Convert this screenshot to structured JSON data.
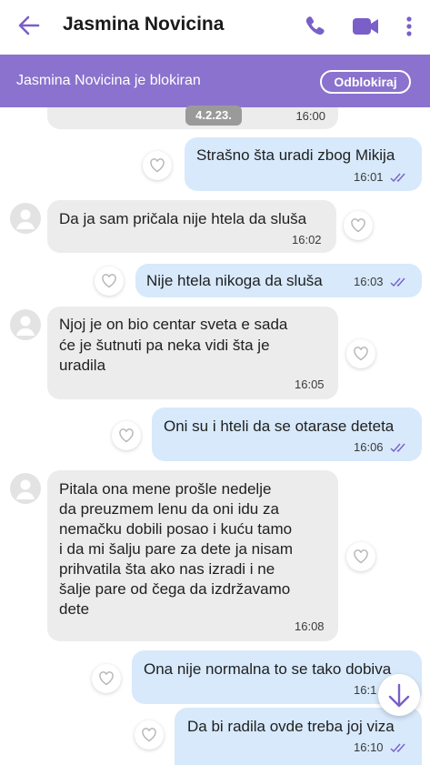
{
  "header": {
    "contact_name": "Jasmina Novicina"
  },
  "blocked_banner": {
    "text": "Jasmina Novicina je blokiran",
    "unblock_label": "Odblokiraj"
  },
  "date_chip": "4.2.23.",
  "colors": {
    "accent": "#7a5fc8",
    "banner": "#8a72ce",
    "incoming_bubble": "#ececec",
    "outgoing_bubble": "#d7e9fb",
    "read_ticks": "#7a5fc8"
  },
  "messages": [
    {
      "direction": "in",
      "lines": [],
      "time": "16:00"
    },
    {
      "direction": "out",
      "lines": [
        "Strašno šta uradi zbog Mikija"
      ],
      "time": "16:01"
    },
    {
      "direction": "in",
      "lines": [
        "Da ja sam pričala nije htela da sluša"
      ],
      "time": "16:02"
    },
    {
      "direction": "out",
      "lines": [
        "Nije htela nikoga da sluša"
      ],
      "time": "16:03"
    },
    {
      "direction": "in",
      "lines": [
        "Njoj je on bio centar sveta e sada",
        "će je šutnuti pa neka vidi šta je",
        "uradila"
      ],
      "time": "16:05"
    },
    {
      "direction": "out",
      "lines": [
        "Oni su i hteli da se otarase deteta"
      ],
      "time": "16:06"
    },
    {
      "direction": "in",
      "lines": [
        "Pitala ona mene prošle nedelje",
        "da preuzmem lenu da oni idu za",
        "nemačku dobili posao i kuću tamo",
        "i da mi šalju pare za dete ja nisam",
        "prihvatila šta ako nas izradi i ne",
        "šalje pare od čega da izdržavamo",
        "dete"
      ],
      "time": "16:08"
    },
    {
      "direction": "out",
      "lines": [
        "Ona nije normalna to se tako dobiva"
      ],
      "time": "16:1"
    },
    {
      "direction": "out",
      "lines": [
        "Da bi radila ovde treba joj viza"
      ],
      "time": "16:10"
    }
  ]
}
